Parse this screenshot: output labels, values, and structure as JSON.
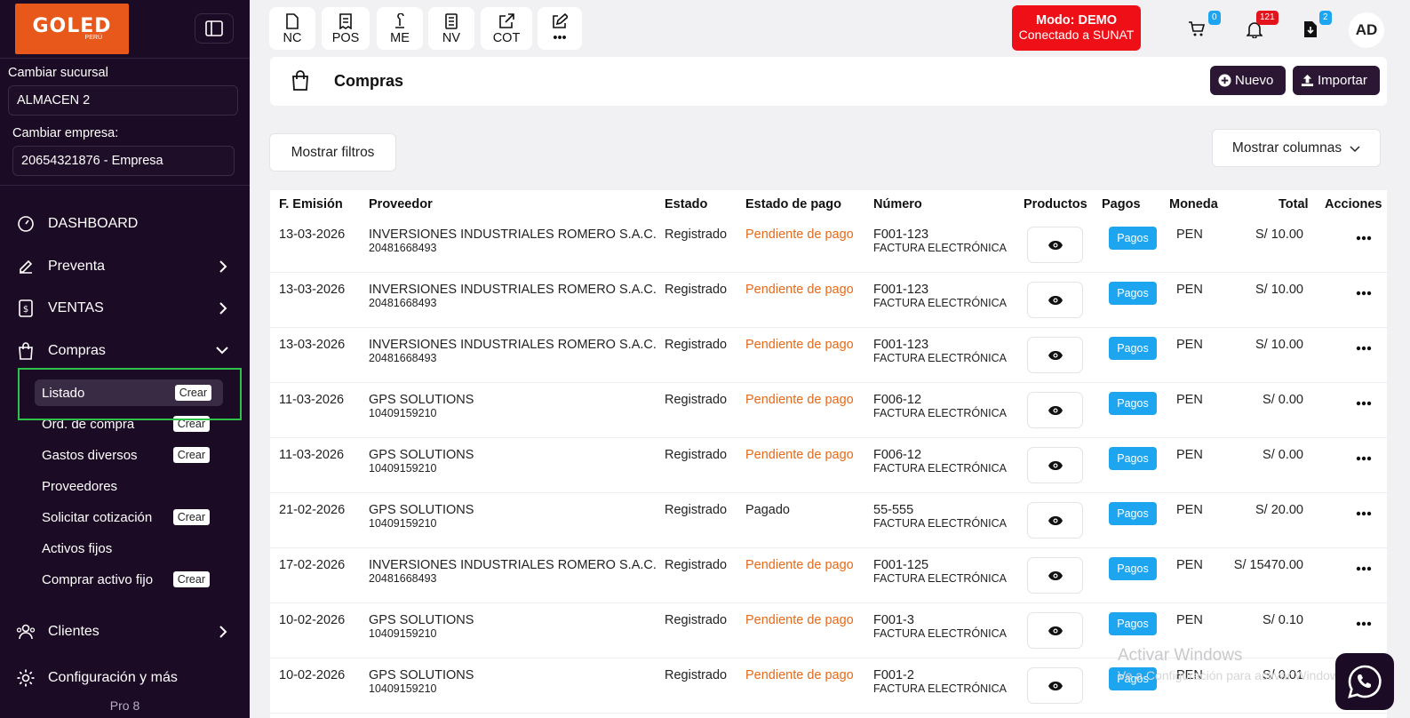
{
  "logo": {
    "brand": "GOLED",
    "sub": "PERÚ"
  },
  "sidebar": {
    "branch_label": "Cambiar sucursal",
    "branch_value": "ALMACEN 2",
    "company_label": "Cambiar empresa:",
    "company_value": "20654321876 - Empresa",
    "nav": [
      {
        "label": "DASHBOARD",
        "icon": "gauge-icon"
      },
      {
        "label": "Preventa",
        "icon": "edit-icon"
      },
      {
        "label": "VENTAS",
        "icon": "receipt-icon"
      },
      {
        "label": "Compras",
        "icon": "shopping-bag-icon"
      }
    ],
    "sub": [
      {
        "label": "Listado",
        "crear": "Crear"
      },
      {
        "label": "Ord. de compra",
        "crear": "Crear"
      },
      {
        "label": "Gastos diversos",
        "crear": "Crear"
      },
      {
        "label": "Proveedores",
        "crear": ""
      },
      {
        "label": "Solicitar cotización",
        "crear": "Crear"
      },
      {
        "label": "Activos fijos",
        "crear": ""
      },
      {
        "label": "Comprar activo fijo",
        "crear": "Crear"
      }
    ],
    "clientes": "Clientes",
    "config": "Configuración y más",
    "version": "Pro 8"
  },
  "topbar": {
    "quick": [
      "NC",
      "POS",
      "ME",
      "NV",
      "COT",
      "•••"
    ],
    "mode_title": "Modo: DEMO",
    "mode_sub": "Conectado a SUNAT",
    "cart_count": "0",
    "notif_count": "121",
    "download_count": "2",
    "avatar": "AD",
    "colors": {
      "mode": "#ef0f17",
      "badge_blue": "#1ea5ef",
      "badge_red": "#e3141b"
    }
  },
  "page": {
    "title": "Compras",
    "new_label": "Nuevo",
    "import_label": "Importar",
    "filters_label": "Mostrar filtros",
    "columns_label": "Mostrar columnas"
  },
  "table": {
    "headers": [
      "F. Emisión",
      "Proveedor",
      "Estado",
      "Estado de pago",
      "Número",
      "Productos",
      "Pagos",
      "Moneda",
      "Total",
      "Acciones"
    ],
    "pagos_label": "Pagos",
    "rows": [
      {
        "fecha": "13-03-2026",
        "proveedor": "INVERSIONES INDUSTRIALES ROMERO S.A.C.",
        "ruc": "20481668493",
        "estado": "Registrado",
        "pago": "Pendiente de pago",
        "numero": "F001-123",
        "tipo": "FACTURA ELECTRÓNICA",
        "moneda": "PEN",
        "total": "S/ 10.00"
      },
      {
        "fecha": "13-03-2026",
        "proveedor": "INVERSIONES INDUSTRIALES ROMERO S.A.C.",
        "ruc": "20481668493",
        "estado": "Registrado",
        "pago": "Pendiente de pago",
        "numero": "F001-123",
        "tipo": "FACTURA ELECTRÓNICA",
        "moneda": "PEN",
        "total": "S/ 10.00"
      },
      {
        "fecha": "13-03-2026",
        "proveedor": "INVERSIONES INDUSTRIALES ROMERO S.A.C.",
        "ruc": "20481668493",
        "estado": "Registrado",
        "pago": "Pendiente de pago",
        "numero": "F001-123",
        "tipo": "FACTURA ELECTRÓNICA",
        "moneda": "PEN",
        "total": "S/ 10.00"
      },
      {
        "fecha": "11-03-2026",
        "proveedor": "GPS SOLUTIONS",
        "ruc": "10409159210",
        "estado": "Registrado",
        "pago": "Pendiente de pago",
        "numero": "F006-12",
        "tipo": "FACTURA ELECTRÓNICA",
        "moneda": "PEN",
        "total": "S/ 0.00"
      },
      {
        "fecha": "11-03-2026",
        "proveedor": "GPS SOLUTIONS",
        "ruc": "10409159210",
        "estado": "Registrado",
        "pago": "Pendiente de pago",
        "numero": "F006-12",
        "tipo": "FACTURA ELECTRÓNICA",
        "moneda": "PEN",
        "total": "S/ 0.00"
      },
      {
        "fecha": "21-02-2026",
        "proveedor": "GPS SOLUTIONS",
        "ruc": "10409159210",
        "estado": "Registrado",
        "pago": "Pagado",
        "numero": "55-555",
        "tipo": "FACTURA ELECTRÓNICA",
        "moneda": "PEN",
        "total": "S/ 20.00"
      },
      {
        "fecha": "17-02-2026",
        "proveedor": "INVERSIONES INDUSTRIALES ROMERO S.A.C.",
        "ruc": "20481668493",
        "estado": "Registrado",
        "pago": "Pendiente de pago",
        "numero": "F001-125",
        "tipo": "FACTURA ELECTRÓNICA",
        "moneda": "PEN",
        "total": "S/ 15470.00"
      },
      {
        "fecha": "10-02-2026",
        "proveedor": "GPS SOLUTIONS",
        "ruc": "10409159210",
        "estado": "Registrado",
        "pago": "Pendiente de pago",
        "numero": "F001-3",
        "tipo": "FACTURA ELECTRÓNICA",
        "moneda": "PEN",
        "total": "S/ 0.10"
      },
      {
        "fecha": "10-02-2026",
        "proveedor": "GPS SOLUTIONS",
        "ruc": "10409159210",
        "estado": "Registrado",
        "pago": "Pendiente de pago",
        "numero": "F001-2",
        "tipo": "FACTURA ELECTRÓNICA",
        "moneda": "PEN",
        "total": "S/ 0.01"
      }
    ]
  },
  "watermark": {
    "title": "Activar Windows",
    "sub": "Ve a Configuración para activar Windows."
  }
}
